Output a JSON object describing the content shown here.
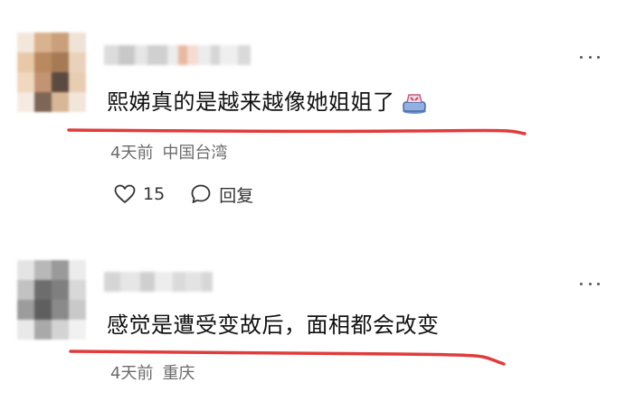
{
  "comments": [
    {
      "text": "熙娣真的是越来越像她姐姐了",
      "emoji": "crying-face-emoji",
      "time": "4天前",
      "location": "中国台湾",
      "like_count": "15",
      "reply_label": "回复",
      "underline_color": "#e23b3b"
    },
    {
      "text": "感觉是遭受变故后，面相都会改变",
      "time": "4天前",
      "location": "重庆",
      "underline_color": "#e23b3b"
    }
  ],
  "colors": {
    "meta_text": "#6b6b6b",
    "accent_red": "#e23b3b"
  }
}
